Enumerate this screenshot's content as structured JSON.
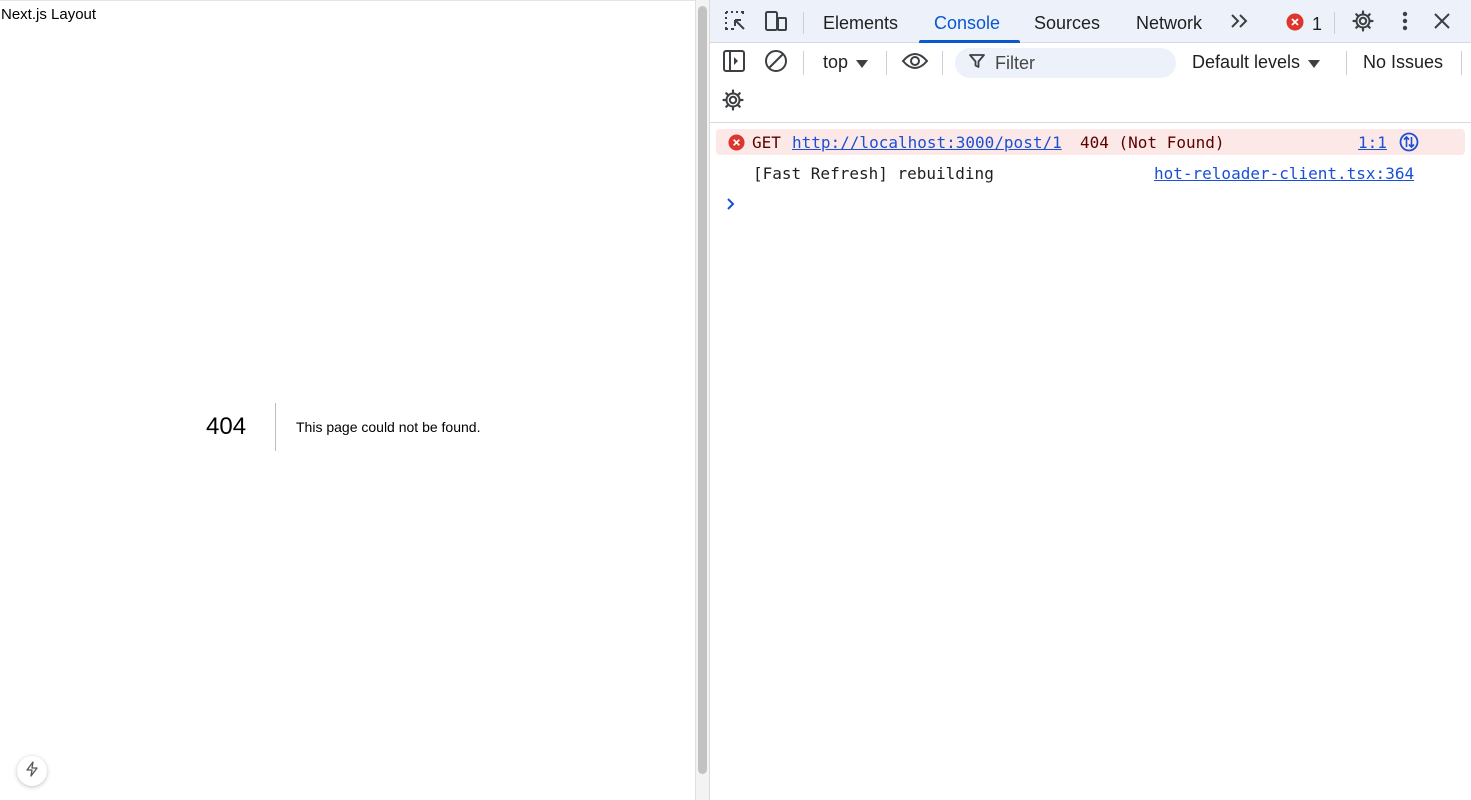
{
  "page": {
    "title": "Next.js Layout",
    "error_code": "404",
    "error_message": "This page could not be found."
  },
  "devtools": {
    "tabs": [
      {
        "label": "Elements"
      },
      {
        "label": "Console"
      },
      {
        "label": "Sources"
      },
      {
        "label": "Network"
      }
    ],
    "active_tab": "Console",
    "error_count": "1",
    "toolbar": {
      "context": "top",
      "filter_placeholder": "Filter",
      "levels": "Default levels",
      "issues": "No Issues"
    },
    "messages": [
      {
        "type": "error",
        "method": "GET",
        "url": "http://localhost:3000/post/1",
        "status": "404 (Not Found)",
        "source": "1:1"
      },
      {
        "type": "log",
        "text": "[Fast Refresh] rebuilding",
        "source": "hot-reloader-client.tsx:364"
      }
    ]
  },
  "colors": {
    "accent": "#0b57d0",
    "error_bg": "#fce8e6",
    "error_red": "#dc362e",
    "link": "#1a4fd6"
  }
}
